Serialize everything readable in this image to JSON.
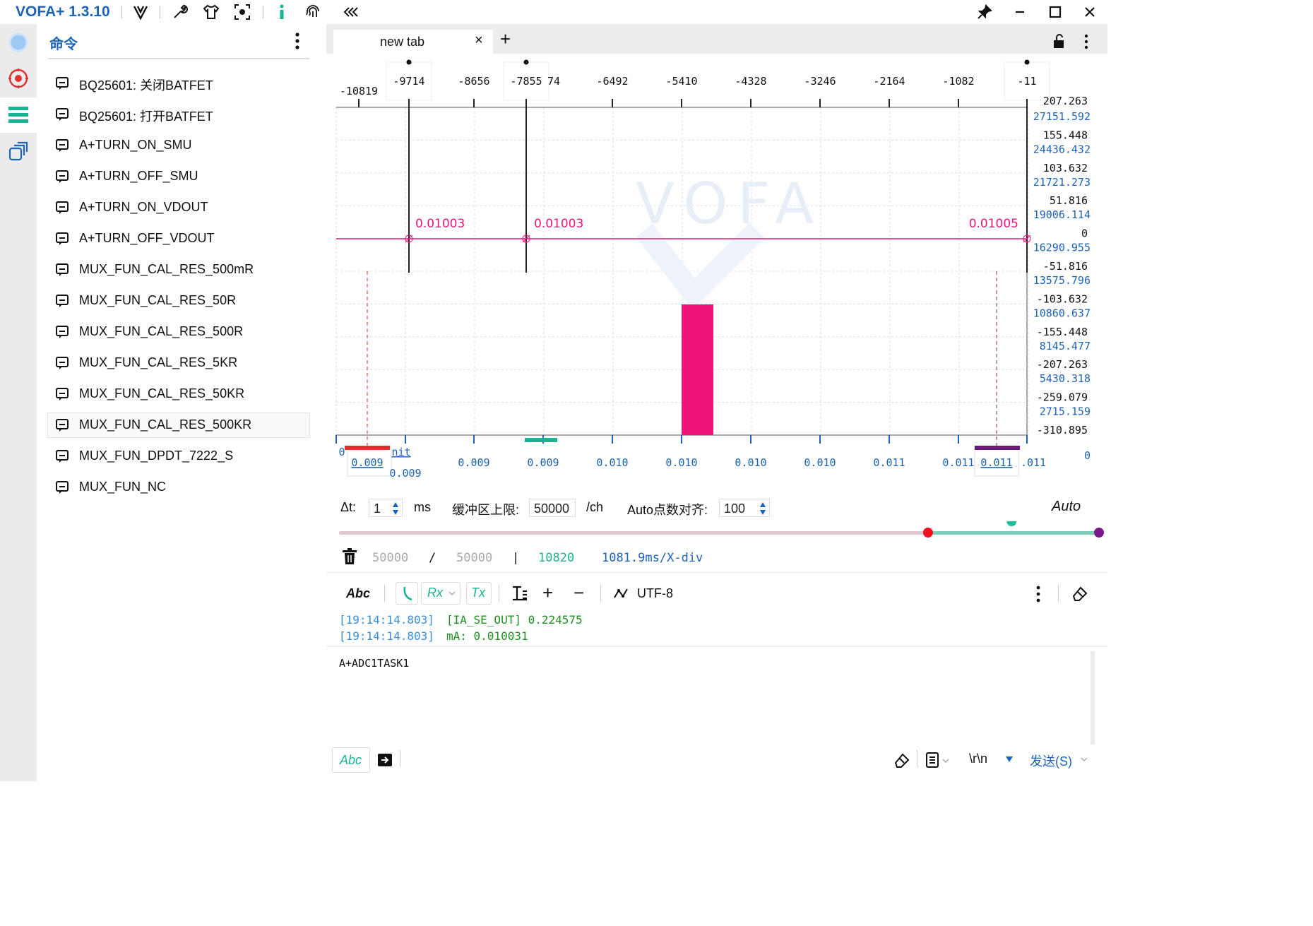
{
  "app": {
    "title": "VOFA+ 1.3.10"
  },
  "toolbar_icons": [
    "vofa-logo-icon",
    "wrench-icon",
    "shirt-icon",
    "screenshot-icon",
    "info-icon",
    "fingerprint-icon",
    "collapse-icon"
  ],
  "window_icons": [
    "pin-icon",
    "minimize-icon",
    "maximize-icon",
    "close-icon"
  ],
  "rail": [
    {
      "icon": "connection-icon",
      "color": "#9ec8f5"
    },
    {
      "icon": "record-icon",
      "color": "#e03030"
    },
    {
      "icon": "menu-lines-icon",
      "color": "#19b394",
      "active": true
    },
    {
      "icon": "windows-icon",
      "color": "#1e63b8"
    }
  ],
  "command_panel": {
    "title": "命令",
    "items": [
      {
        "label": "BQ25601: 关闭BATFET"
      },
      {
        "label": "BQ25601: 打开BATFET"
      },
      {
        "label": "A+TURN_ON_SMU"
      },
      {
        "label": "A+TURN_OFF_SMU"
      },
      {
        "label": "A+TURN_ON_VDOUT"
      },
      {
        "label": "A+TURN_OFF_VDOUT"
      },
      {
        "label": "MUX_FUN_CAL_RES_500mR"
      },
      {
        "label": "MUX_FUN_CAL_RES_50R"
      },
      {
        "label": "MUX_FUN_CAL_RES_500R"
      },
      {
        "label": "MUX_FUN_CAL_RES_5KR"
      },
      {
        "label": "MUX_FUN_CAL_RES_50KR"
      },
      {
        "label": "MUX_FUN_CAL_RES_500KR",
        "selected": true
      },
      {
        "label": "MUX_FUN_DPDT_7222_S"
      },
      {
        "label": "MUX_FUN_NC"
      }
    ]
  },
  "tabs": [
    {
      "label": "new tab",
      "close": "×"
    }
  ],
  "tab_add": "+",
  "chart_data": [
    {
      "type": "line",
      "top_axis_ticks": [
        "-10819",
        "-9714",
        "-8656",
        "-7855",
        "74",
        "-6492",
        "-5410",
        "-4328",
        "-3246",
        "-2164",
        "-1082",
        "-11"
      ],
      "bottom_axis_ticks": [
        "0",
        "0.009",
        "nit",
        "0.009",
        "0.009",
        "0.009",
        "0.010",
        "0.010",
        "0.010",
        "0.010",
        "0.011",
        "0.011",
        "0.011",
        ".011"
      ],
      "right_axis_primary": [
        "207.263",
        "155.448",
        "103.632",
        "51.816",
        "0",
        "-51.816",
        "-103.632",
        "-155.448",
        "-207.263",
        "-259.079",
        "-310.895"
      ],
      "right_axis_secondary": [
        "27151.592",
        "24436.432",
        "21721.273",
        "19006.114",
        "16290.955",
        "13575.796",
        "10860.637",
        "8145.477",
        "5430.318",
        "2715.159",
        "0"
      ],
      "series": [
        {
          "name": "",
          "color": "#f0147a",
          "values": [
            0.01003,
            0.01003,
            0.01005
          ]
        }
      ],
      "annotations": [
        "0.01003",
        "0.01003",
        "0.01005"
      ],
      "watermark": "VOFA"
    }
  ],
  "settings": {
    "dt_label": "Δt:",
    "dt_value": "1",
    "dt_unit": "ms",
    "buffer_label": "缓冲区上限:",
    "buffer_value": "50000",
    "buffer_unit": "/ch",
    "auto_label": "Auto点数对齐:",
    "auto_value": "100",
    "mode": "Auto"
  },
  "slider": {
    "start_fraction": 0.0,
    "red_fraction": 0.775,
    "teal_fraction": 0.885,
    "end_fraction": 1.0
  },
  "stats": {
    "count_a": "50000",
    "sep1": "/",
    "count_b": "50000",
    "sep2": "|",
    "points": "10820",
    "xdiv": "1081.9ms/X-div"
  },
  "rx_toolbar": {
    "abc": "Abc",
    "rx": "Rx",
    "tx": "Tx",
    "encoding": "UTF-8",
    "plus": "+",
    "minus": "−"
  },
  "log": [
    {
      "time": "[19:14:14.803]",
      "text": "[IA_SE_OUT] 0.224575"
    },
    {
      "time": "[19:14:14.803]",
      "text": "mA: 0.010031"
    }
  ],
  "send": {
    "input": "A+ADC1TASK1",
    "abc": "Abc",
    "line_ending": "\\r\\n",
    "send_label": "发送(S)"
  }
}
